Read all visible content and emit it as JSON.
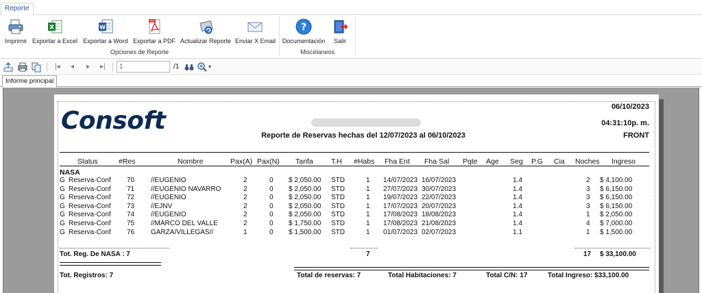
{
  "ribbon": {
    "tab": "Reporte",
    "groups": [
      {
        "label": "Opciones de Reporte"
      },
      {
        "label": "Miscelaneos"
      }
    ],
    "buttons": {
      "print": "Imprimir",
      "excel": "Exportar a Excel",
      "word": "Exportar a Word",
      "pdf": "Exportar a PDF",
      "refresh": "Actualizar Reporte",
      "email": "Enviar X Email",
      "docs": "Documentación",
      "exit": "Salir"
    }
  },
  "toolbar": {
    "page_value": "1",
    "page_total": "/1"
  },
  "doc_tab": "Informe principal",
  "report": {
    "logo": "Consoft",
    "title": "Reporte de Reservas hechas del 12/07/2023 al 06/10/2023",
    "date": "06/10/2023",
    "time": "04:31:10p. m.",
    "section": "FRONT",
    "columns": [
      "Status",
      "#Res",
      "Nombre",
      "Pax(A)",
      "Pax(N)",
      "Tarifa",
      "T.H",
      "#Habs",
      "Fha Ent",
      "Fha Sal",
      "Pqte",
      "Age",
      "Seg",
      "P.G",
      "Cia",
      "Noches",
      "Ingreso"
    ],
    "group": "NASA",
    "rows": [
      {
        "g": "G",
        "status": "Reserva-Conf",
        "res": "70",
        "nombre": "//EUGENIO",
        "paxa": "2",
        "paxn": "0",
        "tarifa": "$ 2,050.00",
        "th": "STD",
        "habs": "1",
        "ent": "14/07/2023",
        "sal": "16/07/2023",
        "seg": "1.4",
        "noches": "2",
        "ingreso": "$ 4,100.00"
      },
      {
        "g": "G",
        "status": "Reserva-Conf",
        "res": "71",
        "nombre": "//EUGENIO NAVARRO",
        "paxa": "2",
        "paxn": "0",
        "tarifa": "$ 2,050.00",
        "th": "STD",
        "habs": "1",
        "ent": "27/07/2023",
        "sal": "30/07/2023",
        "seg": "1.4",
        "noches": "3",
        "ingreso": "$ 6,150.00"
      },
      {
        "g": "G",
        "status": "Reserva-Conf",
        "res": "72",
        "nombre": "//EUGENIO",
        "paxa": "2",
        "paxn": "0",
        "tarifa": "$ 2,050.00",
        "th": "STD",
        "habs": "1",
        "ent": "19/07/2023",
        "sal": "22/07/2023",
        "seg": "1.4",
        "noches": "3",
        "ingreso": "$ 6,150.00"
      },
      {
        "g": "G",
        "status": "Reserva-Conf",
        "res": "73",
        "nombre": "//EJNV",
        "paxa": "2",
        "paxn": "0",
        "tarifa": "$ 2,050.00",
        "th": "STD",
        "habs": "1",
        "ent": "17/07/2023",
        "sal": "20/07/2023",
        "seg": "1.4",
        "noches": "3",
        "ingreso": "$ 6,150.00"
      },
      {
        "g": "G",
        "status": "Reserva-Conf",
        "res": "74",
        "nombre": "//EUGENIO",
        "paxa": "2",
        "paxn": "0",
        "tarifa": "$ 2,050.00",
        "th": "STD",
        "habs": "1",
        "ent": "17/08/2023",
        "sal": "18/08/2023",
        "seg": "1.4",
        "noches": "1",
        "ingreso": "$ 2,050.00"
      },
      {
        "g": "G",
        "status": "Reserva-Conf",
        "res": "75",
        "nombre": "//MARCO DEL VALLE",
        "paxa": "2",
        "paxn": "0",
        "tarifa": "$ 1,750.00",
        "th": "STD",
        "habs": "1",
        "ent": "17/08/2023",
        "sal": "21/08/2023",
        "seg": "1.4",
        "noches": "4",
        "ingreso": "$ 7,000.00"
      },
      {
        "g": "G",
        "status": "Reserva-Conf",
        "res": "76",
        "nombre": "GARZA/VILLEGAS//",
        "paxa": "1",
        "paxn": "0",
        "tarifa": "$ 1,500.00",
        "th": "STD",
        "habs": "1",
        "ent": "01/07/2023",
        "sal": "02/07/2023",
        "seg": "1.1",
        "noches": "1",
        "ingreso": "$ 1,500.00"
      }
    ],
    "group_total": {
      "label": "Tot. Reg. De NASA : 7",
      "habs": "7",
      "noches": "17",
      "ingreso": "$ 33,100.00"
    },
    "grand": {
      "registros": "Tot. Registros: 7",
      "reservas": "Total de reservas: 7",
      "habitaciones": "Total Habitaciones: 7",
      "cn": "Total C/N: 17",
      "ingreso": "Total Ingreso: $33,100.00"
    }
  }
}
